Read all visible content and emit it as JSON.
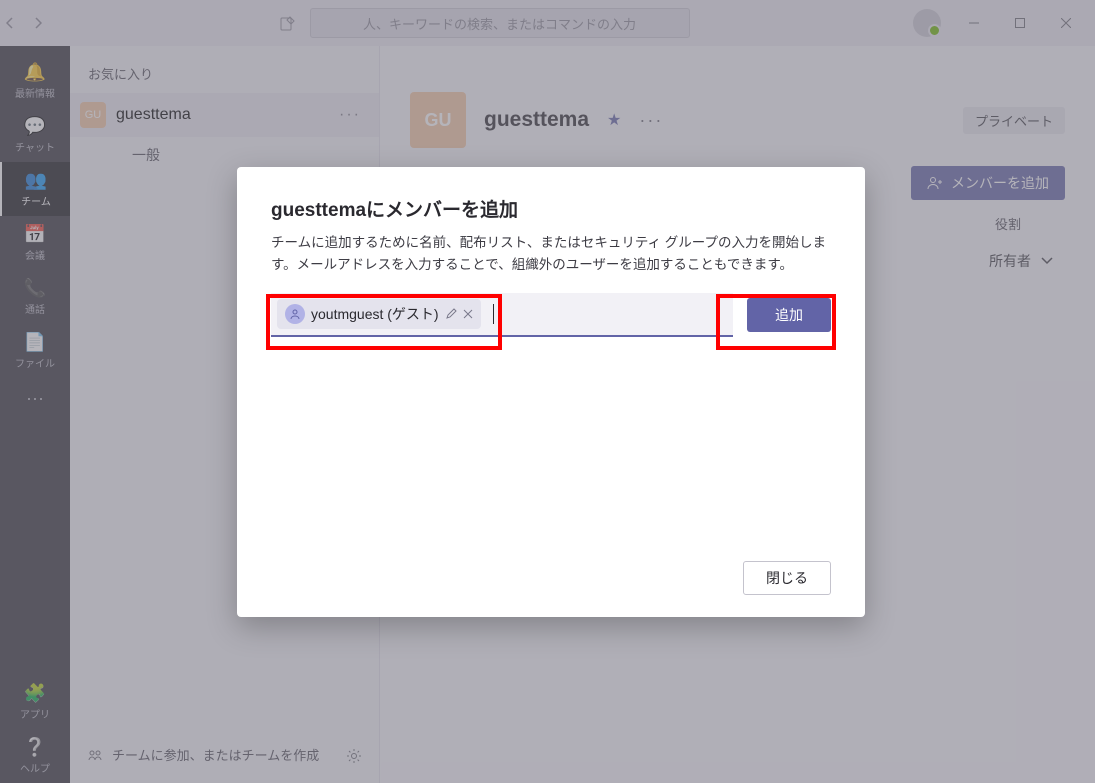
{
  "titlebar": {
    "search_placeholder": "人、キーワードの検索、またはコマンドの入力"
  },
  "rail": [
    {
      "icon": "🔔",
      "label": "最新情報"
    },
    {
      "icon": "💬",
      "label": "チャット"
    },
    {
      "icon": "👥",
      "label": "チーム"
    },
    {
      "icon": "📅",
      "label": "会議"
    },
    {
      "icon": "📞",
      "label": "通話"
    },
    {
      "icon": "📄",
      "label": "ファイル"
    }
  ],
  "rail_bottom": [
    {
      "icon": "🧩",
      "label": "アプリ"
    },
    {
      "icon": "❔",
      "label": "ヘルプ"
    }
  ],
  "sidebar": {
    "header": "お気に入り",
    "team": {
      "initials": "GU",
      "name": "guesttema",
      "more": "···"
    },
    "channels": [
      "一般"
    ],
    "footer_icon": "⚙",
    "footer_text": "チームに参加、またはチームを作成",
    "footer_gear": "⚙"
  },
  "main": {
    "chip_initials": "GU",
    "title": "guesttema",
    "star": "★",
    "more": "···",
    "privacy": "プライベート",
    "add_btn": "メンバーを追加",
    "role_header": "役割",
    "role_value": "所有者"
  },
  "dialog": {
    "title": "guesttemaにメンバーを追加",
    "desc": "チームに追加するために名前、配布リスト、またはセキュリティ グループの入力を開始します。メールアドレスを入力することで、組織外のユーザーを追加することもできます。",
    "chip": "youtmguest (ゲスト)",
    "add": "追加",
    "close": "閉じる"
  }
}
